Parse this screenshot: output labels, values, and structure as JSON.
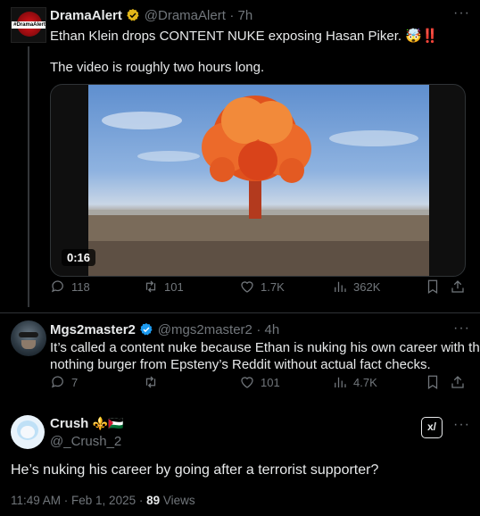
{
  "tweet1": {
    "display_name": "DramaAlert",
    "handle": "@DramaAlert",
    "time": "· 7h",
    "avatar_text": "#DramaAlert",
    "text_line1": "Ethan Klein drops CONTENT NUKE exposing Hasan Piker. 🤯‼️",
    "text_line2": "The video is roughly two hours long.",
    "video_duration": "0:16",
    "replies": "118",
    "reposts": "101",
    "likes": "1.7K",
    "views": "362K"
  },
  "tweet2": {
    "display_name": "Mgs2master2",
    "handle": "@mgs2master2",
    "time": "· 4h",
    "text_line1": "It’s called a content nuke because Ethan is nuking his own career with this",
    "text_line2": "nothing burger from Epsteny’s Reddit without actual fact checks.",
    "replies": "7",
    "reposts": "",
    "likes": "101",
    "views": "4.7K"
  },
  "tweet3": {
    "display_name": "Crush",
    "name_emojis": "⚜️🇵🇸",
    "handle": "@_Crush_2",
    "text": "He’s nuking his career by going after a terrorist supporter?",
    "date": "11:49 AM · Feb 1, 2025 · ",
    "views_count": "89",
    "views_label": " Views",
    "grok_label": "x/"
  },
  "colors": {
    "background": "#000000",
    "verified": "#1d9bf0",
    "muted": "#71767b",
    "alert_red": "#f4212e"
  },
  "icons": [
    "more-icon",
    "reply-icon",
    "repost-icon",
    "like-icon",
    "views-icon",
    "bookmark-icon",
    "share-icon",
    "verified-icon",
    "grok-icon"
  ]
}
